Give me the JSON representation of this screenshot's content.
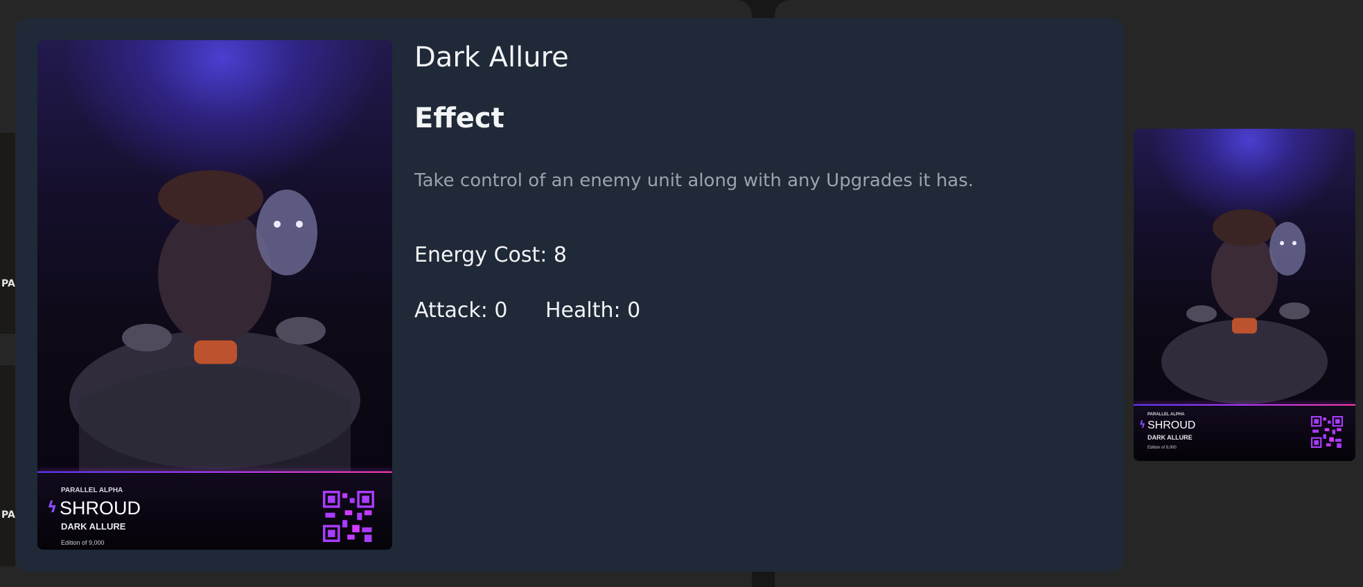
{
  "background": {
    "left_strip_label_1": "PA",
    "left_strip_label_2": "PA"
  },
  "modal": {
    "title": "Dark Allure",
    "effect_heading": "Effect",
    "effect_text": "Take control of an enemy unit along with any Upgrades it has.",
    "energy_cost": "Energy Cost: 8",
    "attack": "Attack: 0",
    "health": "Health: 0"
  },
  "card": {
    "set_label": "PARALLEL ALPHA",
    "parallel_name": "SHROUD",
    "card_name": "DARK ALLURE",
    "edition": "Edition of 9,000",
    "bolt_icon": "lightning-bolt-icon",
    "colors": {
      "accent_purple": "#8a4dff",
      "accent_pink": "#ff3ca8",
      "qr": "#a83cff"
    }
  }
}
